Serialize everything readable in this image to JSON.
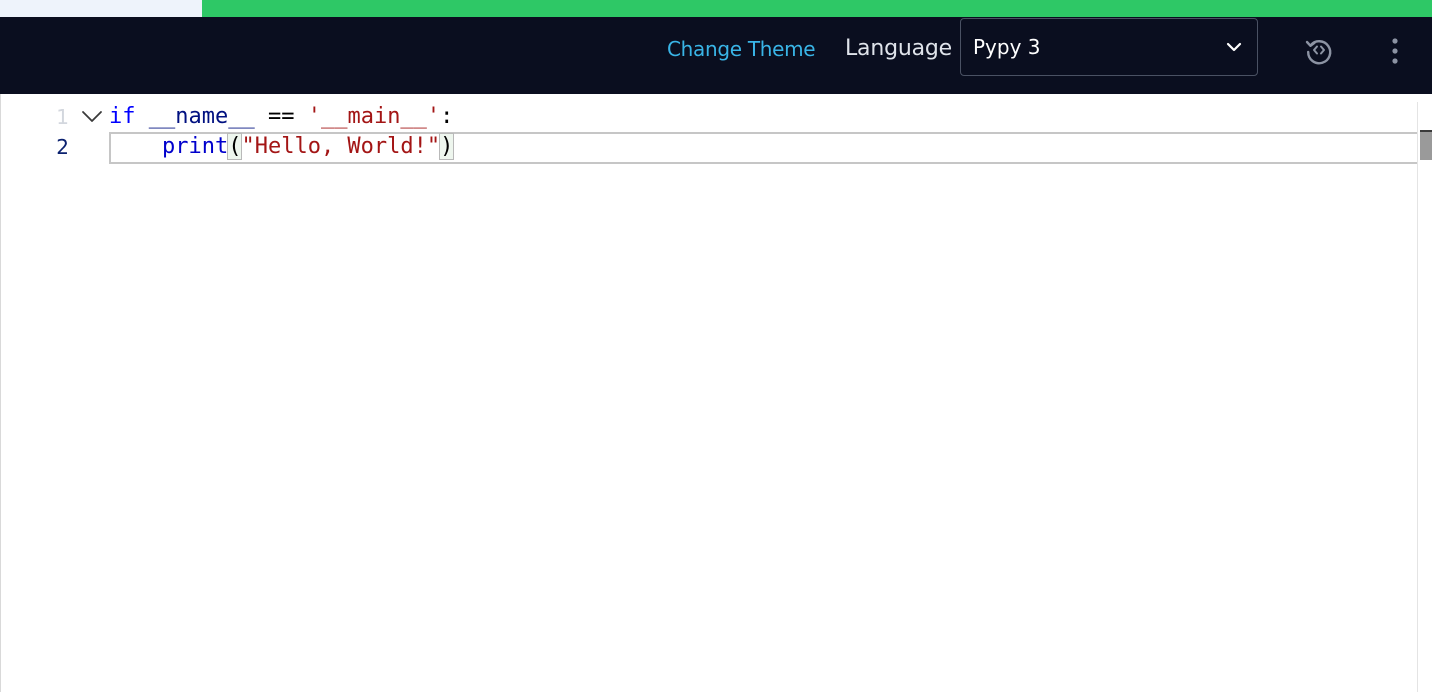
{
  "progress": {
    "fraction": 0.859,
    "track_color": "#eef3fb",
    "fill_color": "#2ec866"
  },
  "toolbar": {
    "change_theme_label": "Change Theme",
    "language_label": "Language",
    "language_selected": "Pypy 3",
    "icons": [
      "chevron-down-icon",
      "reset-code-icon",
      "more-vertical-icon"
    ],
    "background": "#0a0e1f",
    "accent": "#39b4e6"
  },
  "editor": {
    "line_numbers": [
      "1",
      "2"
    ],
    "line1": {
      "kw_if": "if",
      "sp1": " ",
      "name_var": "__name__",
      "sp2": " ",
      "eq": "==",
      "sp3": " ",
      "main_str": "'__main__'",
      "colon": ":"
    },
    "line2": {
      "indent": "    ",
      "fn_print": "print",
      "lparen": "(",
      "hello_str": "\"Hello, World!\"",
      "rparen": ")"
    }
  }
}
